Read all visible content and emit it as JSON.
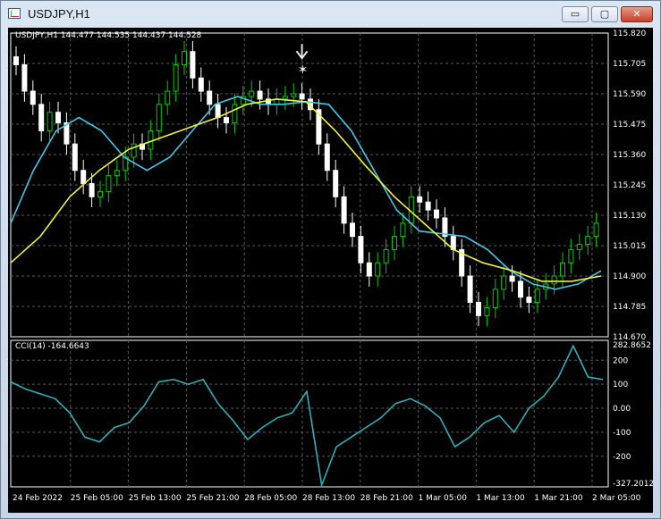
{
  "window": {
    "title": "USDJPY,H1",
    "buttons": {
      "minimize": "▭",
      "maximize": "▢",
      "close": "✕"
    }
  },
  "main_chart": {
    "header": "USDJPY,H1  144.477 144.535 144.437 144.528",
    "price_axis": [
      "115.820",
      "115.705",
      "115.590",
      "115.475",
      "115.360",
      "115.245",
      "115.130",
      "115.015",
      "114.900",
      "114.785",
      "114.670"
    ],
    "ma_colors": {
      "fast": "#41c8e8",
      "slow": "#f2f23a"
    },
    "candle_colors": {
      "bull": "#00cc00",
      "bear": "#ffffff",
      "background": "#000000",
      "grid": "#5a5a5a"
    }
  },
  "cci": {
    "header": "CCI(14) -164.6643",
    "axis_labels": [
      "282.8652",
      "200",
      "100",
      "0.00",
      "-100",
      "-200",
      "-327.2012"
    ],
    "line_color": "#2fb0b8"
  },
  "time_axis": [
    "24 Feb 2022",
    "25 Feb 05:00",
    "25 Feb 13:00",
    "25 Feb 21:00",
    "28 Feb 05:00",
    "28 Feb 13:00",
    "28 Feb 21:00",
    "1 Mar 05:00",
    "1 Mar 13:00",
    "1 Mar 21:00",
    "2 Mar 05:00"
  ],
  "chart_data": [
    {
      "type": "candlestick",
      "symbol": "USDJPY",
      "timeframe": "H1",
      "ohlc_header": {
        "open": 144.477,
        "high": 144.535,
        "low": 144.437,
        "close": 144.528
      },
      "ylim": [
        114.67,
        115.82
      ],
      "x_ticks": [
        "24 Feb 2022",
        "25 Feb 05:00",
        "25 Feb 13:00",
        "25 Feb 21:00",
        "28 Feb 05:00",
        "28 Feb 13:00",
        "28 Feb 21:00",
        "1 Mar 05:00",
        "1 Mar 13:00",
        "1 Mar 21:00",
        "2 Mar 05:00"
      ],
      "close": [
        115.7,
        115.6,
        115.55,
        115.45,
        115.52,
        115.48,
        115.4,
        115.3,
        115.25,
        115.2,
        115.22,
        115.28,
        115.3,
        115.35,
        115.4,
        115.38,
        115.45,
        115.55,
        115.6,
        115.7,
        115.75,
        115.65,
        115.6,
        115.55,
        115.5,
        115.48,
        115.55,
        115.58,
        115.6,
        115.57,
        115.55,
        115.57,
        115.58,
        115.59,
        115.57,
        115.53,
        115.4,
        115.3,
        115.2,
        115.1,
        115.05,
        114.95,
        114.9,
        114.95,
        115.0,
        115.05,
        115.1,
        115.2,
        115.18,
        115.15,
        115.12,
        115.05,
        115.0,
        114.9,
        114.8,
        114.75,
        114.78,
        114.85,
        114.9,
        114.88,
        114.82,
        114.8,
        114.85,
        114.87,
        114.9,
        114.95,
        115.0,
        115.02,
        115.05,
        115.1
      ],
      "series": [
        {
          "name": "",
          "color": "#41c8e8",
          "values": [
            115.1,
            115.3,
            115.45,
            115.5,
            115.45,
            115.35,
            115.3,
            115.35,
            115.45,
            115.55,
            115.58,
            115.55,
            115.55,
            115.56,
            115.55,
            115.45,
            115.3,
            115.15,
            115.07,
            115.06,
            115.05,
            115.0,
            114.92,
            114.87,
            114.85,
            114.87,
            114.92
          ]
        },
        {
          "name": "",
          "color": "#f2f23a",
          "values": [
            114.95,
            115.05,
            115.2,
            115.3,
            115.38,
            115.42,
            115.46,
            115.5,
            115.55,
            115.57,
            115.56,
            115.45,
            115.32,
            115.2,
            115.1,
            115.0,
            114.95,
            114.92,
            114.88,
            114.88,
            114.9
          ]
        }
      ]
    },
    {
      "type": "line",
      "title": "CCI(14) -164.6643",
      "ylim": [
        -327.2012,
        282.8652
      ],
      "y_ticks": [
        200,
        100,
        0,
        -100,
        -200
      ],
      "series": [
        {
          "name": "CCI(14)",
          "values": [
            110,
            80,
            60,
            40,
            -20,
            -120,
            -140,
            -80,
            -60,
            10,
            110,
            120,
            100,
            120,
            20,
            -50,
            -130,
            -80,
            -40,
            -20,
            70,
            -320,
            -160,
            -120,
            -80,
            -40,
            20,
            40,
            10,
            -40,
            -160,
            -120,
            -60,
            -30,
            -100,
            0,
            50,
            130,
            260,
            130,
            120
          ]
        }
      ]
    }
  ]
}
